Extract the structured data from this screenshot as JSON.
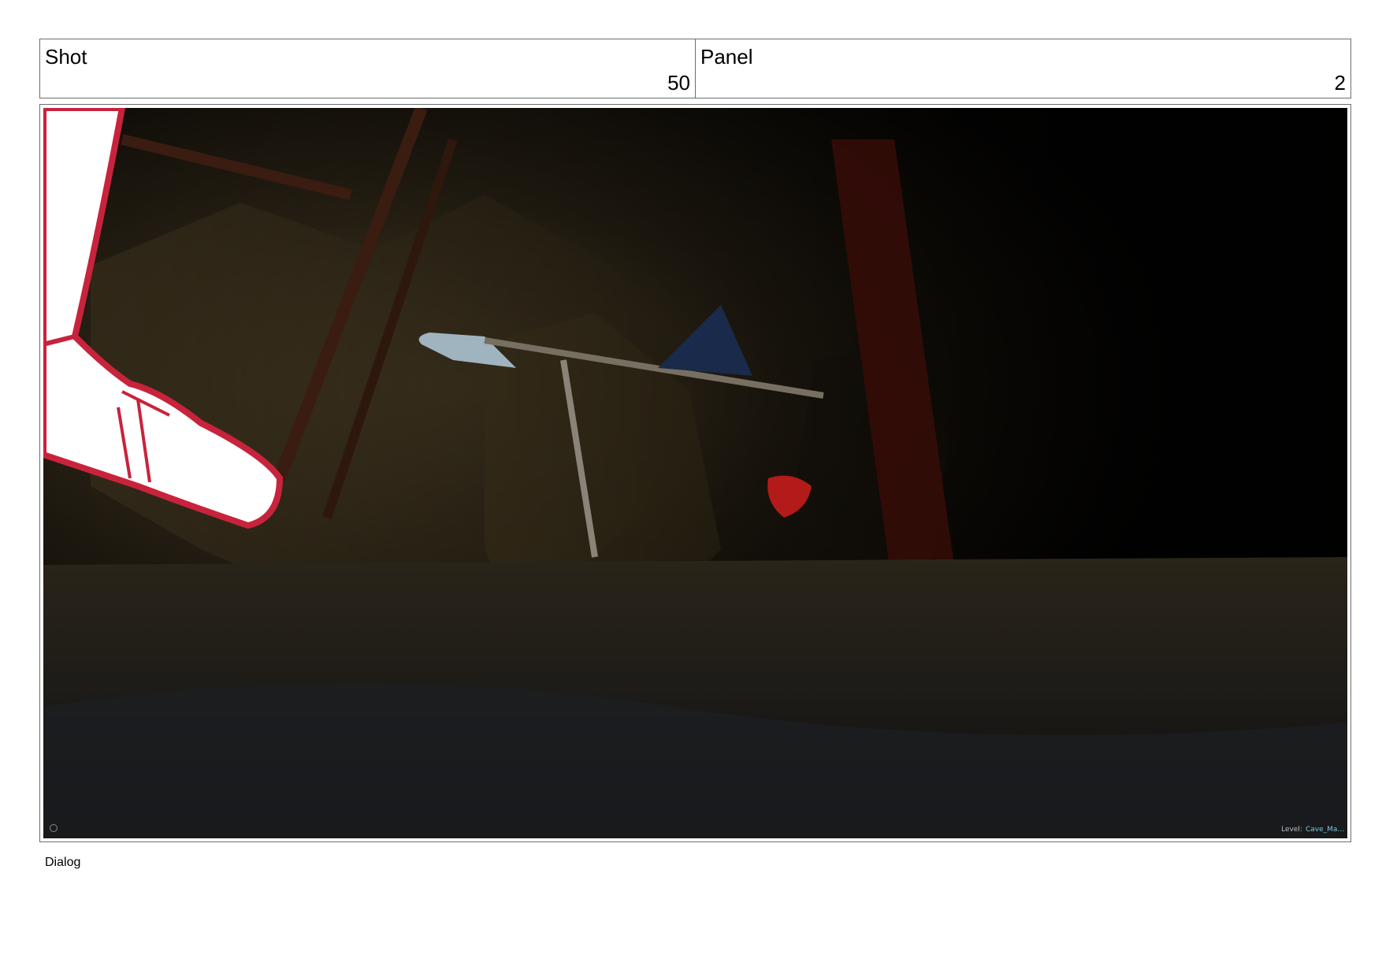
{
  "header": {
    "shot_label": "Shot",
    "shot_value": "50",
    "panel_label": "Panel",
    "panel_value": "2"
  },
  "frame": {
    "level_key": "Level:",
    "level_value": "Cave_Ma..."
  },
  "dialog_label": "Dialog",
  "colors": {
    "border": "#6e6e6e",
    "sketch_red": "#c8233c",
    "level_text": "#7fc7d8"
  }
}
